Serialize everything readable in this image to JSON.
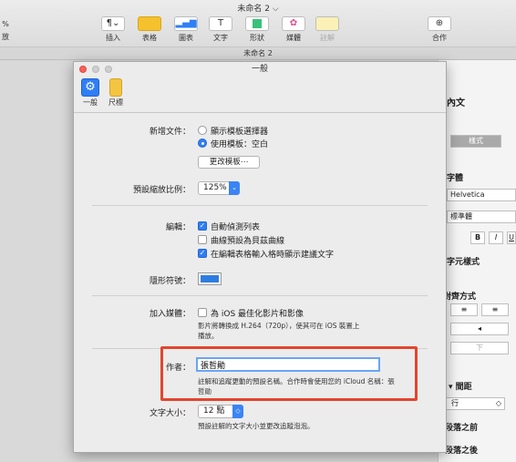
{
  "app": {
    "window_title": "未命名 2",
    "tab_title": "未命名 2",
    "zoom_fragment": "%",
    "left_fragment": "放",
    "toolbar": [
      {
        "icon": "paragraph-icon",
        "label": "插入"
      },
      {
        "icon": "table-icon",
        "label": "表格"
      },
      {
        "icon": "chart-icon",
        "label": "圖表"
      },
      {
        "icon": "text-icon",
        "label": "文字"
      },
      {
        "icon": "shape-icon",
        "label": "形狀"
      },
      {
        "icon": "media-icon",
        "label": "媒體"
      },
      {
        "icon": "comment-icon",
        "label": "註解"
      },
      {
        "icon": "collaborate-icon",
        "label": "合作"
      }
    ]
  },
  "inspector": {
    "heading": "內文",
    "style_tab": "樣式",
    "font_label": "字體",
    "font_name": "Helvetica",
    "font_style": "標準體",
    "bold": "B",
    "italic": "I",
    "underline": "U",
    "char_style": "字元樣式",
    "alignment": "對齊方式",
    "spacing": "間距",
    "spacing_value": "行",
    "before_para": "段落之前",
    "after_para": "段落之後"
  },
  "dialog": {
    "title": "一般",
    "tabs": [
      {
        "icon": "general-icon",
        "label": "一般"
      },
      {
        "icon": "ruler-icon",
        "label": "尺標"
      }
    ],
    "new_doc": {
      "label": "新增文件：",
      "opt1": "顯示模板選擇器",
      "opt2": "使用模板：空白",
      "change_button": "更改模板⋯"
    },
    "zoom": {
      "label": "預設縮放比例：",
      "value": "125%"
    },
    "editing": {
      "label": "編輯：",
      "opt1": "自動偵測列表",
      "opt2": "曲線預設為貝茲曲線",
      "opt3": "在編輯表格輸入格時顯示建議文字"
    },
    "invisibles": {
      "label": "隱形符號：",
      "color": "#2d7de0"
    },
    "media": {
      "label": "加入媒體：",
      "opt1": "為 iOS 最佳化影片和影像",
      "note_line1": "影片將轉換成 H.264（720p），使其可在 iOS 裝置上",
      "note_line2": "播放。"
    },
    "author": {
      "label": "作者：",
      "value": "張哲勛",
      "note_line1": "註解和追蹤更動的預設名稱。合作時會使用您的 iCloud 名稱：張",
      "note_line2": "哲勛"
    },
    "text_size": {
      "label": "文字大小：",
      "value": "12 點",
      "note": "預設註解的文字大小並更改追蹤泡泡。"
    }
  }
}
